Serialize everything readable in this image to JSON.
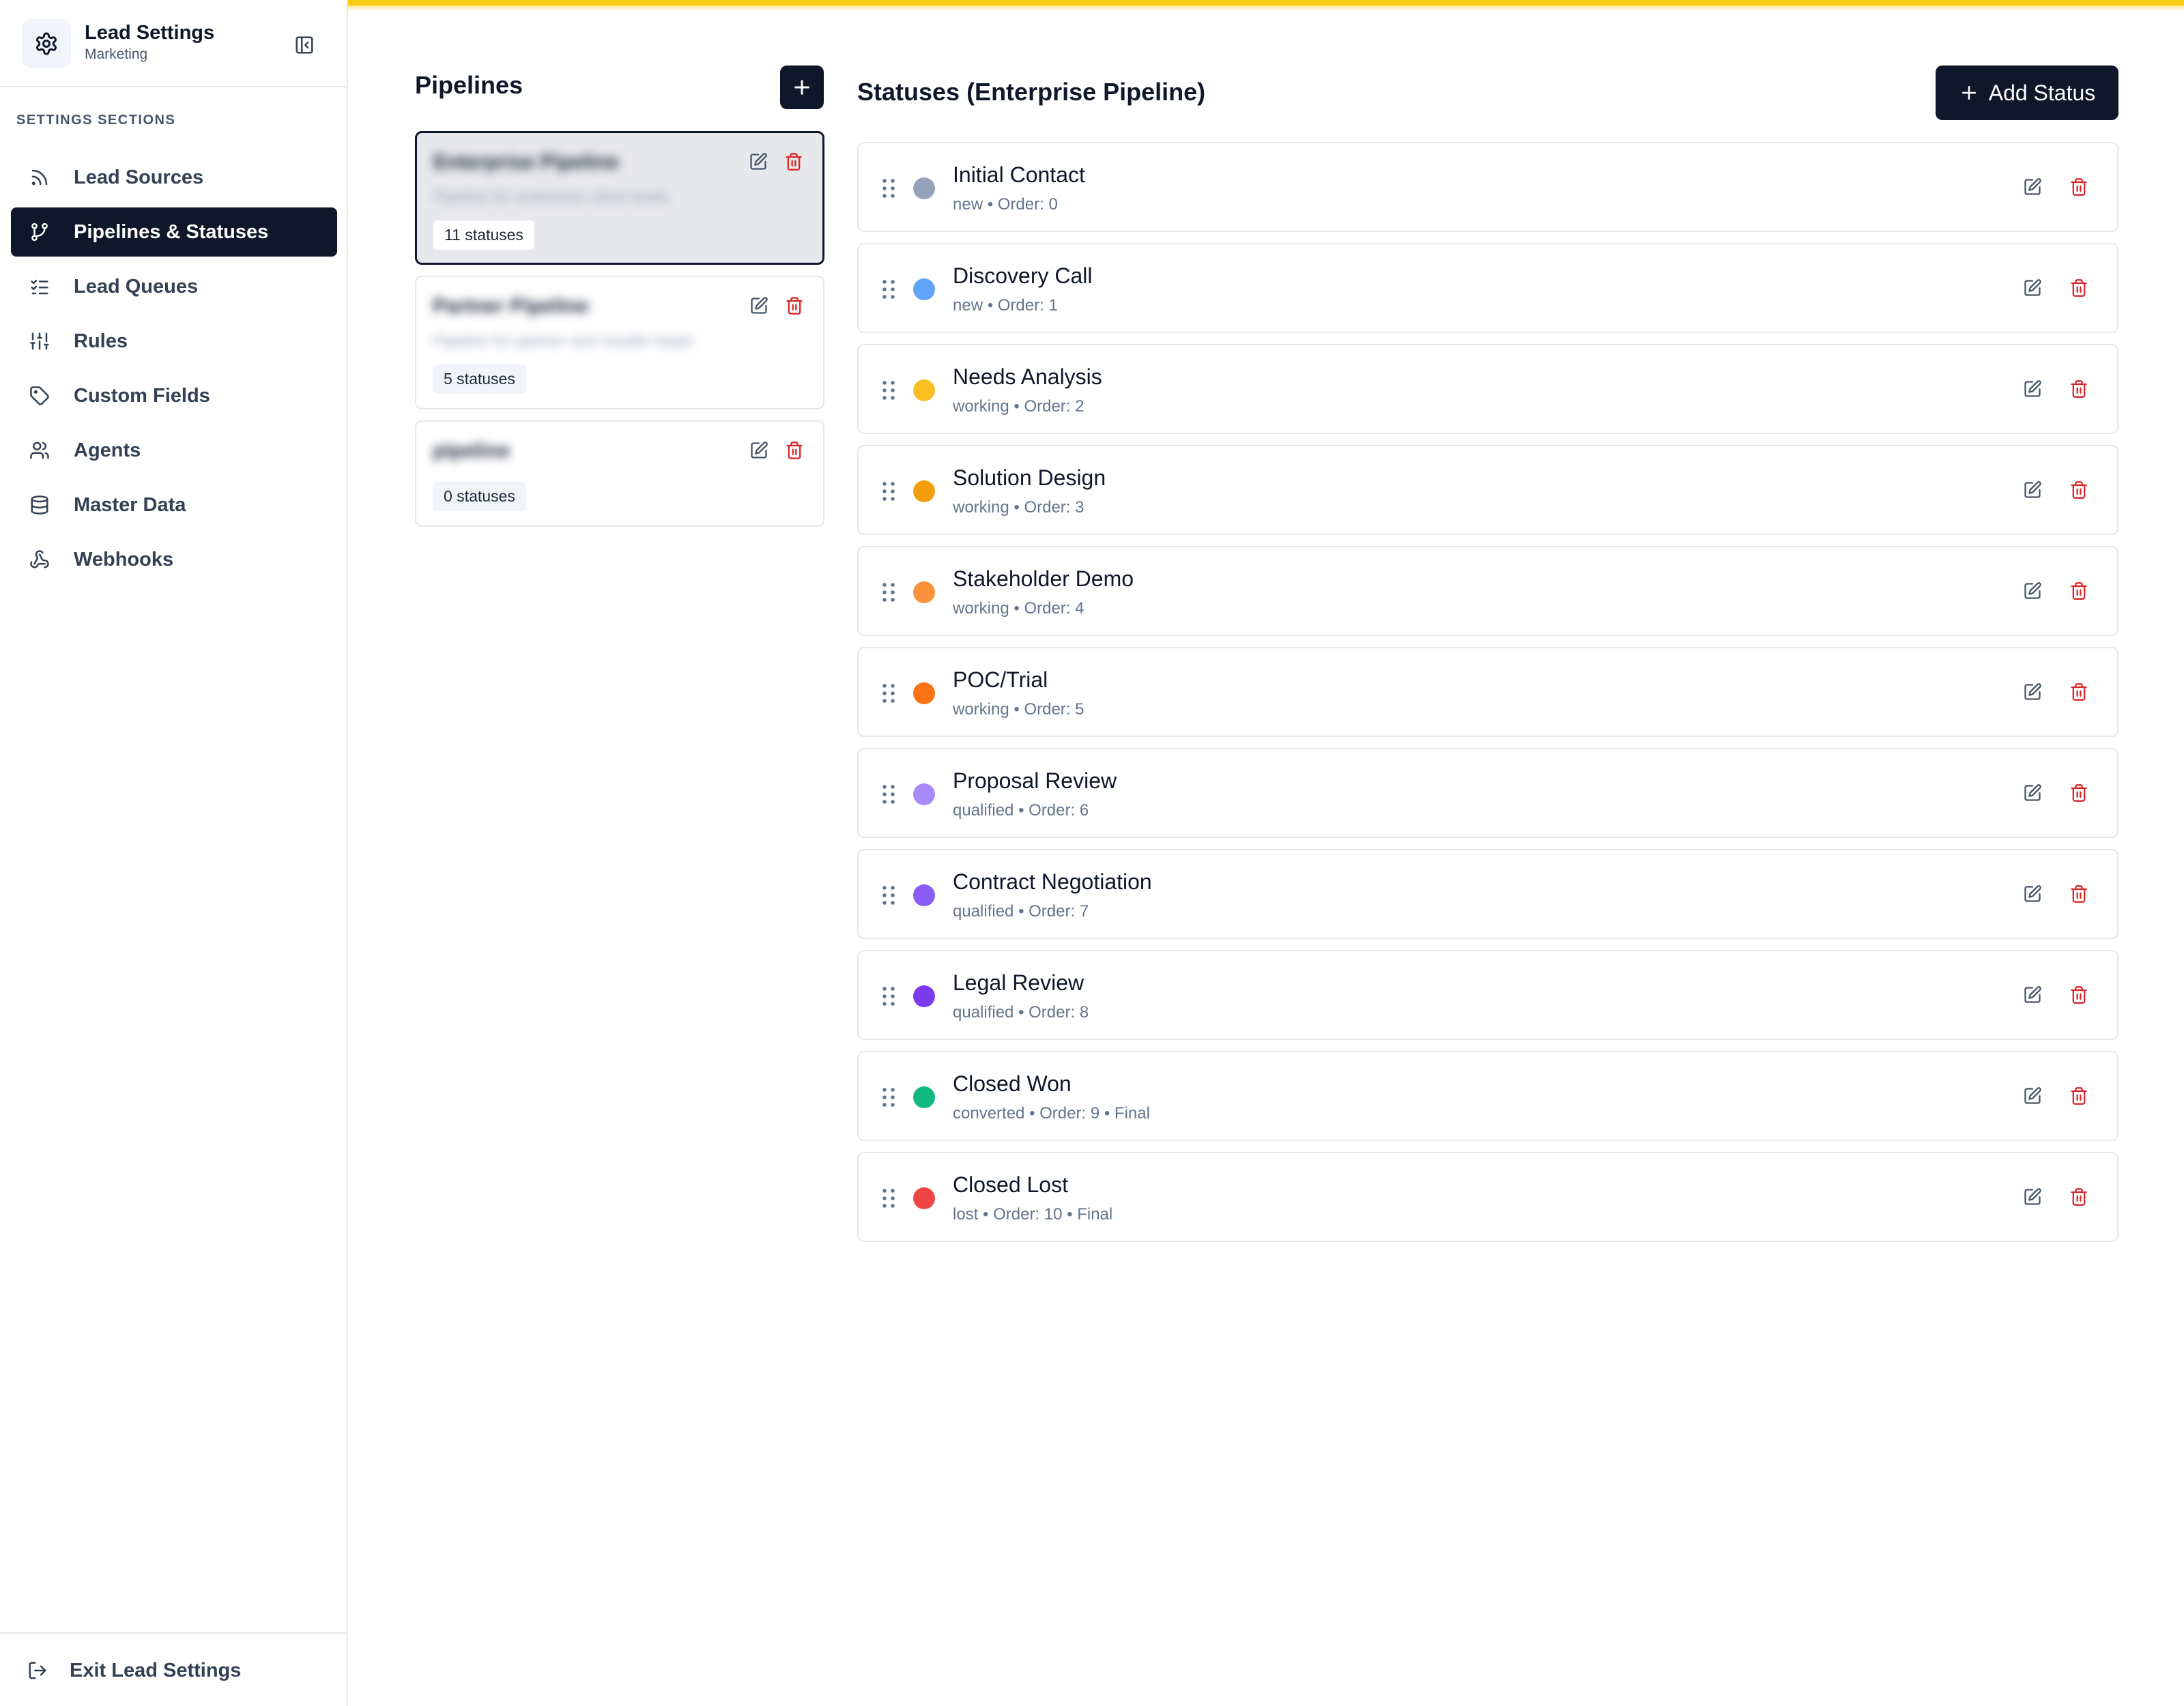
{
  "app": {
    "title": "Lead Settings",
    "subtitle": "Marketing"
  },
  "sidebar": {
    "section_title": "SETTINGS SECTIONS",
    "items": [
      {
        "label": "Lead Sources",
        "icon": "rss-icon",
        "active": false
      },
      {
        "label": "Pipelines & Statuses",
        "icon": "git-branch-icon",
        "active": true
      },
      {
        "label": "Lead Queues",
        "icon": "list-checks-icon",
        "active": false
      },
      {
        "label": "Rules",
        "icon": "sliders-icon",
        "active": false
      },
      {
        "label": "Custom Fields",
        "icon": "tag-icon",
        "active": false
      },
      {
        "label": "Agents",
        "icon": "users-icon",
        "active": false
      },
      {
        "label": "Master Data",
        "icon": "database-icon",
        "active": false
      },
      {
        "label": "Webhooks",
        "icon": "webhook-icon",
        "active": false
      }
    ],
    "exit_label": "Exit Lead Settings"
  },
  "pipelines": {
    "title": "Pipelines",
    "items": [
      {
        "name": "Enterprise Pipeline",
        "description": "Pipeline for enterprise client leads",
        "count_label": "11 statuses",
        "selected": true
      },
      {
        "name": "Partner Pipeline",
        "description": "Pipeline for partner and reseller leads",
        "count_label": "5 statuses",
        "selected": false
      },
      {
        "name": "pipeline",
        "description": "",
        "count_label": "0 statuses",
        "selected": false
      }
    ]
  },
  "statuses": {
    "title": "Statuses (Enterprise Pipeline)",
    "add_label": "Add Status",
    "items": [
      {
        "name": "Initial Contact",
        "meta": "new • Order: 0",
        "color": "#94a3b8"
      },
      {
        "name": "Discovery Call",
        "meta": "new • Order: 1",
        "color": "#60a5fa"
      },
      {
        "name": "Needs Analysis",
        "meta": "working • Order: 2",
        "color": "#fbbf24"
      },
      {
        "name": "Solution Design",
        "meta": "working • Order: 3",
        "color": "#f59e0b"
      },
      {
        "name": "Stakeholder Demo",
        "meta": "working • Order: 4",
        "color": "#fb923c"
      },
      {
        "name": "POC/Trial",
        "meta": "working • Order: 5",
        "color": "#f97316"
      },
      {
        "name": "Proposal Review",
        "meta": "qualified • Order: 6",
        "color": "#a78bfa"
      },
      {
        "name": "Contract Negotiation",
        "meta": "qualified • Order: 7",
        "color": "#8b5cf6"
      },
      {
        "name": "Legal Review",
        "meta": "qualified • Order: 8",
        "color": "#7c3aed"
      },
      {
        "name": "Closed Won",
        "meta": "converted • Order: 9 • Final",
        "color": "#10b981"
      },
      {
        "name": "Closed Lost",
        "meta": "lost • Order: 10 • Final",
        "color": "#ef4444"
      }
    ]
  },
  "colors": {
    "accent": "#0f172a",
    "danger": "#dc2626",
    "top_bar": "#facc15"
  }
}
